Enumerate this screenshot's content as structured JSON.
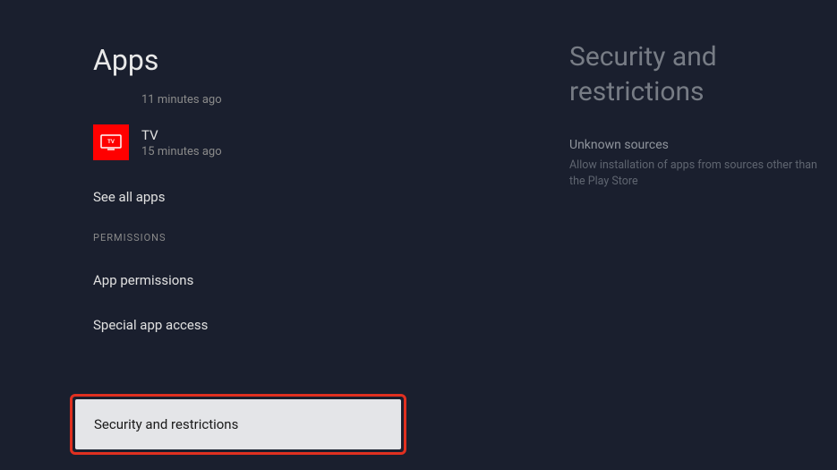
{
  "leftPanel": {
    "title": "Apps",
    "previousTimestamp": "11 minutes ago",
    "apps": [
      {
        "name": "TV",
        "timestamp": "15 minutes ago"
      }
    ],
    "seeAll": "See all apps",
    "sectionHeader": "PERMISSIONS",
    "items": {
      "appPermissions": "App permissions",
      "specialAppAccess": "Special app access",
      "securityRestrictions": "Security and restrictions"
    }
  },
  "rightPanel": {
    "title": "Security and restrictions",
    "settings": [
      {
        "name": "Unknown sources",
        "description": "Allow installation of apps from sources other than the Play Store"
      }
    ]
  }
}
